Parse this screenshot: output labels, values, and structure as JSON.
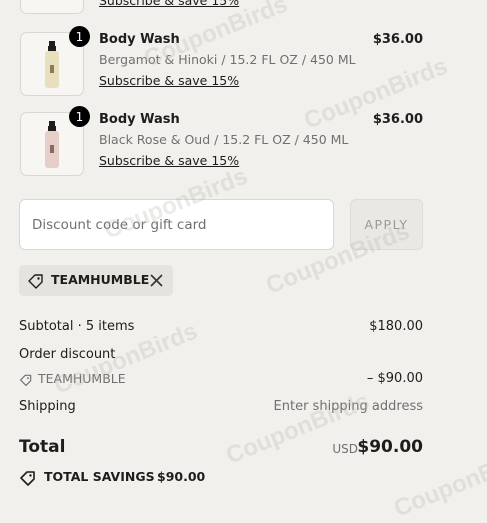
{
  "items": [
    {
      "name": "Body Wash",
      "variant": "Bergamot & Hinoki / 15.2 FL OZ / 450 ML",
      "price": "$36.00",
      "quantity": "1",
      "subscribe": "Subscribe & save 15%",
      "label_color": "#e8dfbf"
    },
    {
      "name": "Body Wash",
      "variant": "Black Rose & Oud / 15.2 FL OZ / 450 ML",
      "price": "$36.00",
      "quantity": "1",
      "subscribe": "Subscribe & save 15%",
      "label_color": "#e6cfc8"
    }
  ],
  "partial_item": {
    "subscribe": "Subscribe & save 15%"
  },
  "discount": {
    "placeholder": "Discount code or gift card",
    "apply_label": "APPLY"
  },
  "applied_code": {
    "code": "TEAMHUMBLE"
  },
  "summary": {
    "subtotal_label": "Subtotal · 5 items",
    "subtotal_value": "$180.00",
    "order_discount_label": "Order discount",
    "discount_code": "TEAMHUMBLE",
    "discount_value": "– $90.00",
    "shipping_label": "Shipping",
    "shipping_value": "Enter shipping address",
    "total_label": "Total",
    "currency": "USD",
    "total_value": "$90.00",
    "savings_label": "TOTAL SAVINGS",
    "savings_value": "$90.00"
  },
  "watermark": "CouponBirds"
}
